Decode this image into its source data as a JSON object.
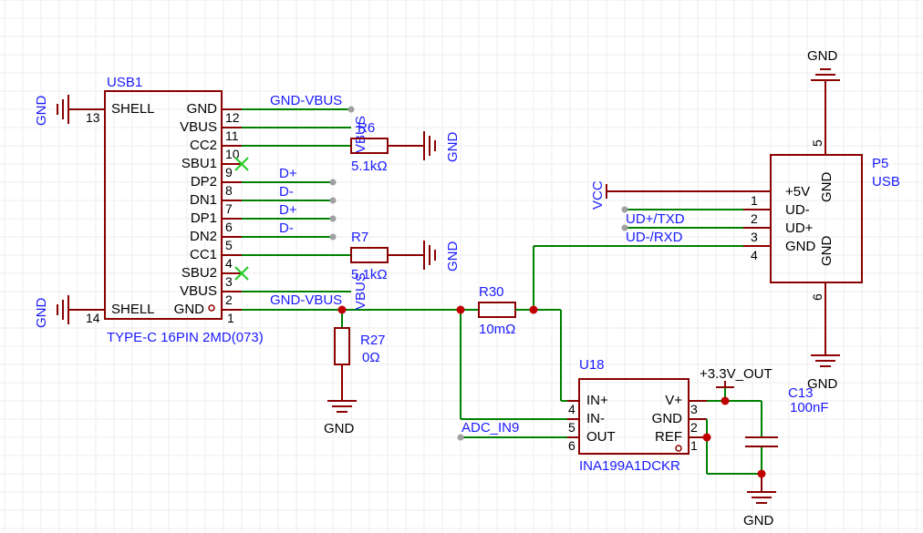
{
  "colors": {
    "wire": "#008000",
    "component": "#8b0000",
    "net_label": "#1a1aff",
    "junction": "#c00000",
    "no_connect": "#22cc22",
    "background": "#ffffff"
  },
  "usb1": {
    "designator": "USB1",
    "part": "TYPE-C 16PIN 2MD(073)",
    "left_pins": [
      {
        "num": "13",
        "name": "SHELL"
      },
      {
        "num": "14",
        "name": "SHELL"
      }
    ],
    "right_pins": [
      {
        "num": "12",
        "name": "GND"
      },
      {
        "num": "11",
        "name": "VBUS"
      },
      {
        "num": "10",
        "name": "CC2"
      },
      {
        "num": "9",
        "name": "SBU1"
      },
      {
        "num": "8",
        "name": "DP2"
      },
      {
        "num": "7",
        "name": "DN1"
      },
      {
        "num": "6",
        "name": "DP1"
      },
      {
        "num": "5",
        "name": "DN2"
      },
      {
        "num": "4",
        "name": "CC1"
      },
      {
        "num": "3",
        "name": "SBU2"
      },
      {
        "num": "2",
        "name": "VBUS"
      },
      {
        "num": "1",
        "name": "GND"
      }
    ]
  },
  "r6": {
    "designator": "R6",
    "value": "5.1kΩ"
  },
  "r7": {
    "designator": "R7",
    "value": "5.1kΩ"
  },
  "r27": {
    "designator": "R27",
    "value": "0Ω"
  },
  "r30": {
    "designator": "R30",
    "value": "10mΩ"
  },
  "c13": {
    "designator": "C13",
    "value": "100nF"
  },
  "u18": {
    "designator": "U18",
    "part": "INA199A1DCKR",
    "left_pins": [
      {
        "num": "4",
        "name": "IN+"
      },
      {
        "num": "5",
        "name": "IN-"
      },
      {
        "num": "6",
        "name": "OUT"
      }
    ],
    "right_pins": [
      {
        "num": "3",
        "name": "V+"
      },
      {
        "num": "2",
        "name": "GND"
      },
      {
        "num": "1",
        "name": "REF"
      }
    ]
  },
  "p5": {
    "designator": "P5",
    "part": "USB",
    "left_pins": [
      {
        "num": "1",
        "name": "+5V"
      },
      {
        "num": "2",
        "name": "UD-"
      },
      {
        "num": "3",
        "name": "UD+"
      },
      {
        "num": "4",
        "name": "GND"
      }
    ],
    "top_pin": {
      "num": "5",
      "name": "GND"
    },
    "bottom_pin": {
      "num": "6",
      "name": "GND"
    }
  },
  "net_labels": {
    "gnd_vbus": "GND-VBUS",
    "vbus": "VBUS",
    "gnd": "GND",
    "d_plus": "D+",
    "d_minus": "D-",
    "vcc": "VCC",
    "ud_txd": "UD+/TXD",
    "ud_rxd": "UD-/RXD",
    "adc_in9": "ADC_IN9",
    "v3_3_out": "+3.3V_OUT"
  }
}
